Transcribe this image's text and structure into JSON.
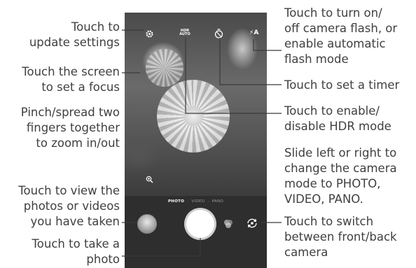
{
  "callouts": {
    "settings": [
      "Touch to",
      "update settings"
    ],
    "focus": [
      "Touch the screen",
      "to set a focus"
    ],
    "zoom": [
      "Pinch/spread two",
      "fingers together",
      "to zoom in/out"
    ],
    "gallery": [
      "Touch to view the",
      "photos or videos",
      "you have taken"
    ],
    "shutter": [
      "Touch to take a",
      "photo"
    ],
    "flash": [
      "Touch to turn on/",
      "off camera flash, or",
      "enable automatic",
      "flash mode"
    ],
    "timer": [
      "Touch to set a timer"
    ],
    "hdr": [
      "Touch to enable/",
      "disable HDR mode"
    ],
    "mode": [
      "Slide left or right to",
      "change the camera",
      "mode to PHOTO,",
      "VIDEO, PANO."
    ],
    "switch": [
      "Touch to switch",
      "between front/back",
      "camera"
    ]
  },
  "screen": {
    "hdr_label_line1": "HDR",
    "hdr_label_line2": "AUTO",
    "flash_label": "A",
    "modes": [
      "PHOTO",
      "VIDEO",
      "PANO"
    ],
    "active_mode": "PHOTO"
  },
  "icons": {
    "settings": "gear-icon",
    "timer": "timer-icon",
    "flash": "flash-auto-icon",
    "zoom": "zoom-icon",
    "filter": "filter-icon",
    "switch": "switch-camera-icon"
  }
}
